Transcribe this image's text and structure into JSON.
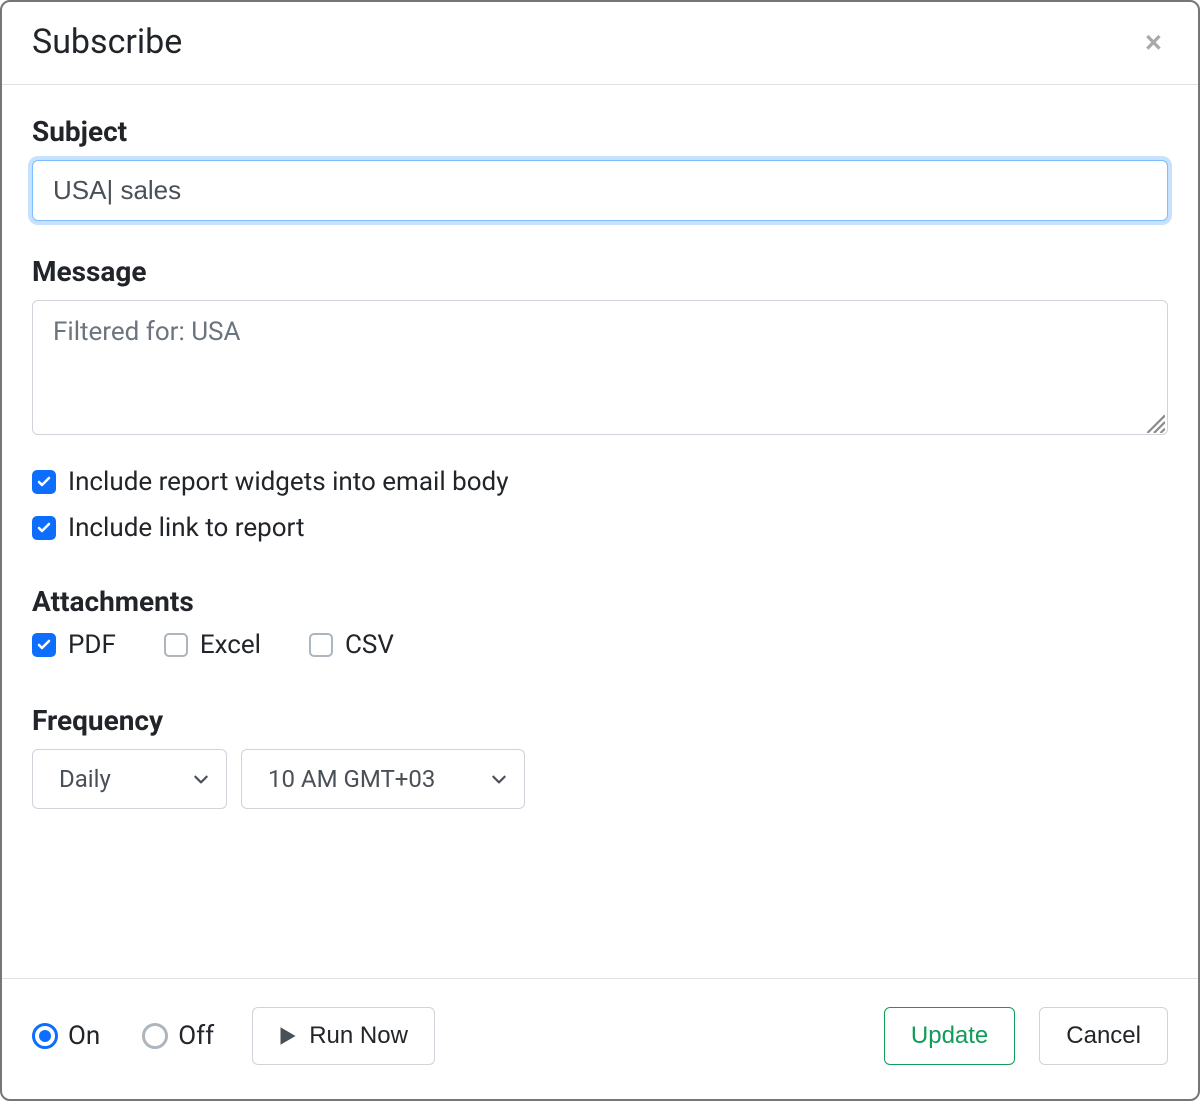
{
  "header": {
    "title": "Subscribe"
  },
  "form": {
    "subject_label": "Subject",
    "subject_value": "USA| sales",
    "message_label": "Message",
    "message_value": "Filtered for: USA",
    "include_widgets_label": "Include report widgets into email body",
    "include_widgets_checked": true,
    "include_link_label": "Include link to report",
    "include_link_checked": true
  },
  "attachments": {
    "label": "Attachments",
    "options": [
      {
        "label": "PDF",
        "checked": true
      },
      {
        "label": "Excel",
        "checked": false
      },
      {
        "label": "CSV",
        "checked": false
      }
    ]
  },
  "frequency": {
    "label": "Frequency",
    "interval": "Daily",
    "time": "10 AM GMT+03"
  },
  "footer": {
    "state_on": "On",
    "state_off": "Off",
    "state_selected": "on",
    "run_label": "Run Now",
    "update_label": "Update",
    "cancel_label": "Cancel"
  }
}
